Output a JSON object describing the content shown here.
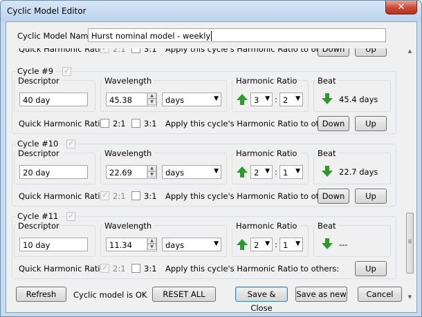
{
  "window": {
    "title": "Cyclic Model Editor",
    "close_glyph": "✕"
  },
  "model": {
    "name_label": "Cyclic Model Name:",
    "name_value": "Hurst nominal model - weekly"
  },
  "labels": {
    "descriptor": "Descriptor",
    "wavelength": "Wavelength",
    "harmonic_ratio": "Harmonic Ratio",
    "beat": "Beat",
    "quick_ratio": "Quick Harmonic Ratio:",
    "ratio_2_1": "2:1",
    "ratio_3_1": "3:1",
    "apply": "Apply this cycle's Harmonic Ratio to others:",
    "colon": ":",
    "down": "Down",
    "up": "Up"
  },
  "partial_row": {
    "quick_ratio": "Quick Harmonic Ratio:",
    "ratio_2_1": "2:1",
    "ratio_3_1": "3:1",
    "apply": "Apply this cycle's Harmonic Ratio to others:",
    "down": "Down",
    "up": "Up"
  },
  "cycles": [
    {
      "title": "Cycle #9",
      "descriptor": "40 day",
      "wavelength": "45.38",
      "unit": "days",
      "ratio_num": "3",
      "ratio_den": "2",
      "beat": "45.4 days",
      "beat_direction": "down",
      "check_2_1": false,
      "check_3_1": false,
      "show_down": true
    },
    {
      "title": "Cycle #10",
      "descriptor": "20 day",
      "wavelength": "22.69",
      "unit": "days",
      "ratio_num": "2",
      "ratio_den": "1",
      "beat": "22.7 days",
      "beat_direction": "down",
      "check_2_1": true,
      "check_3_1": false,
      "show_down": true
    },
    {
      "title": "Cycle #11",
      "descriptor": "10 day",
      "wavelength": "11.34",
      "unit": "days",
      "ratio_num": "2",
      "ratio_den": "1",
      "beat": "---",
      "beat_direction": "down",
      "check_2_1": true,
      "check_3_1": false,
      "show_down": false
    }
  ],
  "footer": {
    "refresh": "Refresh",
    "status": "Cyclic model is OK",
    "reset_all": "RESET ALL",
    "save_close": "Save & Close",
    "save_new": "Save as new",
    "cancel": "Cancel"
  },
  "colors": {
    "arrow_green": "#2e9a2e",
    "title_bar": "#c6dbef"
  },
  "icons": {
    "up_arrow": "green-up-arrow-icon",
    "down_arrow": "green-down-arrow-icon"
  }
}
